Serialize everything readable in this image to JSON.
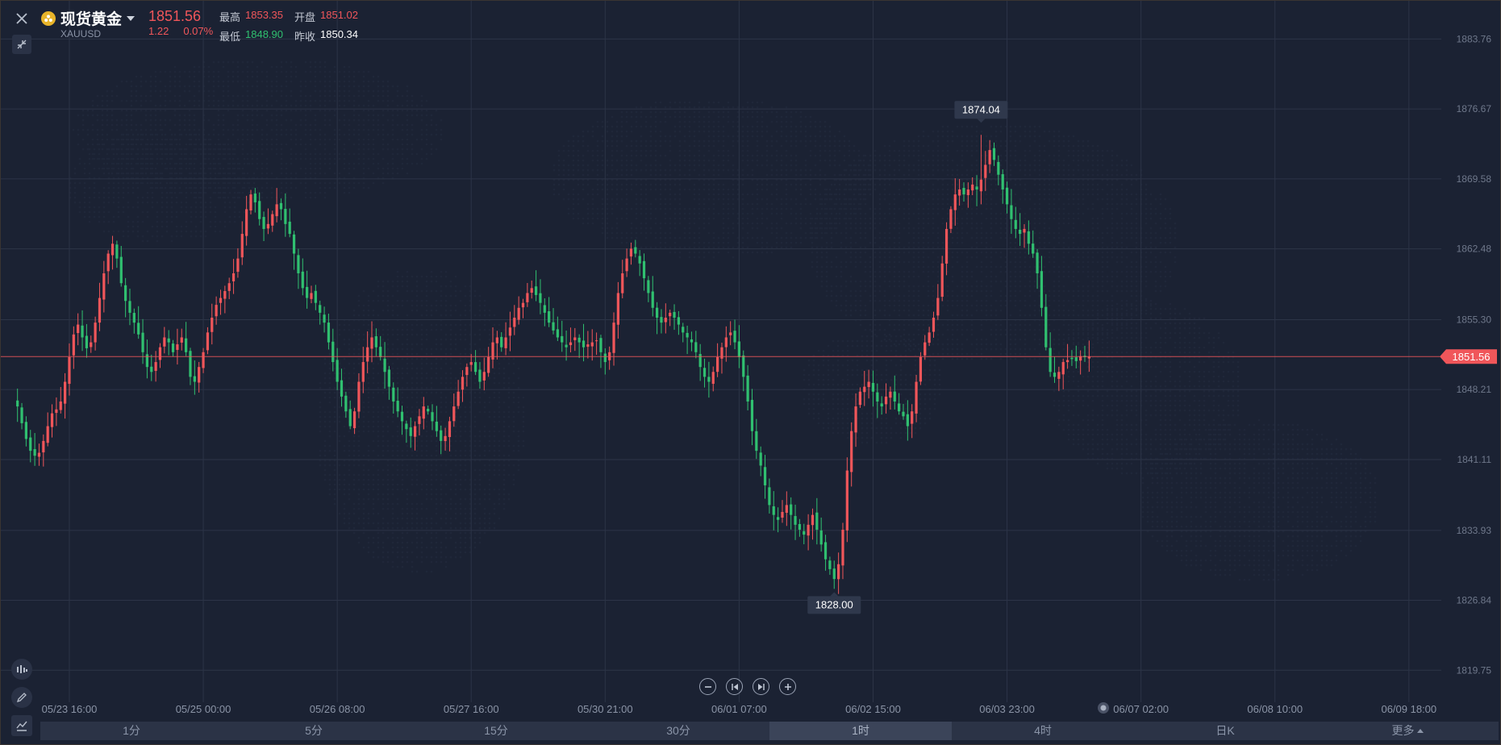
{
  "instrument": {
    "name": "现货黄金",
    "symbol": "XAUUSD",
    "price": "1851.56",
    "change": "1.22",
    "change_pct": "0.07%",
    "stats": [
      {
        "label": "最高",
        "value": "1853.35",
        "trend": "up"
      },
      {
        "label": "开盘",
        "value": "1851.02",
        "trend": "up"
      },
      {
        "label": "最低",
        "value": "1848.90",
        "trend": "down"
      },
      {
        "label": "昨收",
        "value": "1850.34",
        "trend": "flat"
      }
    ]
  },
  "periods": [
    "1分",
    "5分",
    "15分",
    "30分",
    "1时",
    "4时",
    "日K",
    "更多"
  ],
  "active_period": "1时",
  "colors": {
    "up": "#f0565a",
    "down": "#30c070",
    "background": "#1b2233",
    "grid": "#2c3447",
    "accent": "#e8b42a"
  },
  "icons": {
    "close": "close-icon",
    "collapse": "collapse-icon",
    "indicator": "indicator-icon",
    "draw": "pencil-icon",
    "line_tool": "line-chart-icon",
    "zoom_out": "minus-circle-icon",
    "first": "skip-back-icon",
    "last": "skip-forward-icon",
    "zoom_in": "plus-circle-icon"
  },
  "chart_data": {
    "type": "candlestick",
    "y_ticks": [
      "1883.76",
      "1876.67",
      "1869.58",
      "1862.48",
      "1855.30",
      "1848.21",
      "1841.11",
      "1833.93",
      "1826.84",
      "1819.75"
    ],
    "y_tick_values": [
      1883.76,
      1876.67,
      1869.58,
      1862.48,
      1855.3,
      1848.21,
      1841.11,
      1833.93,
      1826.84,
      1819.75
    ],
    "ylim": [
      1816.5,
      1886.0
    ],
    "x_ticks": [
      "05/23 16:00",
      "05/25 00:00",
      "05/26 08:00",
      "05/27 16:00",
      "05/30 21:00",
      "06/01 07:00",
      "06/02 15:00",
      "06/03 23:00",
      "06/07 02:00",
      "06/08 10:00",
      "06/09 18:00"
    ],
    "x_tick_index": [
      12,
      43,
      74,
      105,
      136,
      167,
      198,
      229,
      260,
      291,
      322
    ],
    "total_slots": 330,
    "last_price": "1851.56",
    "last_price_value": 1851.56,
    "max_label": "1874.04",
    "max_value": 1874.04,
    "max_index": 223,
    "min_label": "1828.00",
    "min_value": 1828.0,
    "min_index": 189,
    "close_series": [
      1846.5,
      1844.8,
      1843.2,
      1842.0,
      1841.5,
      1841.8,
      1843.0,
      1844.5,
      1845.8,
      1846.2,
      1847.0,
      1849.0,
      1851.5,
      1853.8,
      1854.8,
      1853.5,
      1852.4,
      1853.0,
      1855.0,
      1857.5,
      1860.0,
      1862.0,
      1863.0,
      1861.5,
      1859.0,
      1857.2,
      1856.0,
      1855.0,
      1853.8,
      1852.0,
      1850.5,
      1850.0,
      1851.0,
      1852.5,
      1853.5,
      1853.0,
      1852.0,
      1852.8,
      1853.5,
      1852.0,
      1849.5,
      1849.0,
      1850.5,
      1852.0,
      1854.0,
      1855.5,
      1856.8,
      1857.5,
      1858.2,
      1859.0,
      1860.0,
      1861.5,
      1864.0,
      1866.5,
      1868.0,
      1867.2,
      1865.5,
      1864.5,
      1865.0,
      1866.0,
      1867.0,
      1866.5,
      1865.0,
      1864.0,
      1862.0,
      1860.0,
      1858.5,
      1857.5,
      1858.0,
      1857.0,
      1856.0,
      1855.0,
      1853.0,
      1851.0,
      1849.0,
      1847.5,
      1846.0,
      1844.5,
      1846.0,
      1849.0,
      1851.0,
      1852.5,
      1853.5,
      1852.5,
      1851.5,
      1850.0,
      1848.5,
      1847.0,
      1846.0,
      1845.0,
      1844.2,
      1843.5,
      1844.5,
      1845.5,
      1846.5,
      1846.0,
      1845.0,
      1844.0,
      1843.0,
      1843.5,
      1845.0,
      1846.5,
      1848.0,
      1849.5,
      1850.5,
      1851.0,
      1850.0,
      1849.0,
      1850.0,
      1851.5,
      1853.0,
      1853.5,
      1852.5,
      1853.5,
      1854.5,
      1855.5,
      1856.5,
      1857.0,
      1858.0,
      1858.5,
      1857.8,
      1857.0,
      1856.0,
      1855.0,
      1854.2,
      1853.5,
      1853.0,
      1852.5,
      1853.0,
      1853.5,
      1853.0,
      1852.5,
      1852.8,
      1853.0,
      1853.2,
      1852.0,
      1851.0,
      1852.0,
      1855.0,
      1858.0,
      1860.0,
      1861.5,
      1862.5,
      1862.0,
      1861.0,
      1859.5,
      1858.0,
      1856.5,
      1855.5,
      1855.0,
      1855.5,
      1856.0,
      1855.5,
      1854.8,
      1854.0,
      1853.5,
      1853.0,
      1852.0,
      1850.5,
      1849.5,
      1849.0,
      1850.0,
      1851.5,
      1852.5,
      1853.5,
      1854.0,
      1853.0,
      1851.5,
      1849.5,
      1847.0,
      1844.0,
      1842.0,
      1840.5,
      1838.5,
      1836.5,
      1835.5,
      1835.0,
      1835.8,
      1836.5,
      1835.5,
      1834.5,
      1834.0,
      1833.5,
      1834.5,
      1835.5,
      1834.0,
      1832.5,
      1831.0,
      1830.0,
      1829.0,
      1830.5,
      1834.0,
      1840.0,
      1844.0,
      1846.5,
      1848.0,
      1848.5,
      1849.0,
      1848.0,
      1847.0,
      1846.5,
      1847.5,
      1848.0,
      1847.0,
      1846.0,
      1845.5,
      1844.5,
      1846.0,
      1849.0,
      1851.5,
      1853.0,
      1854.0,
      1855.5,
      1857.5,
      1861.0,
      1864.5,
      1866.5,
      1868.0,
      1868.5,
      1868.0,
      1868.5,
      1869.0,
      1868.5,
      1869.5,
      1871.0,
      1872.5,
      1871.5,
      1870.0,
      1868.5,
      1867.0,
      1865.5,
      1864.5,
      1864.0,
      1864.5,
      1863.0,
      1862.0,
      1860.0,
      1856.5,
      1852.5,
      1850.0,
      1849.5,
      1850.0,
      1851.0,
      1851.2,
      1851.3,
      1851.1,
      1851.6,
      1851.5,
      1851.56
    ]
  }
}
